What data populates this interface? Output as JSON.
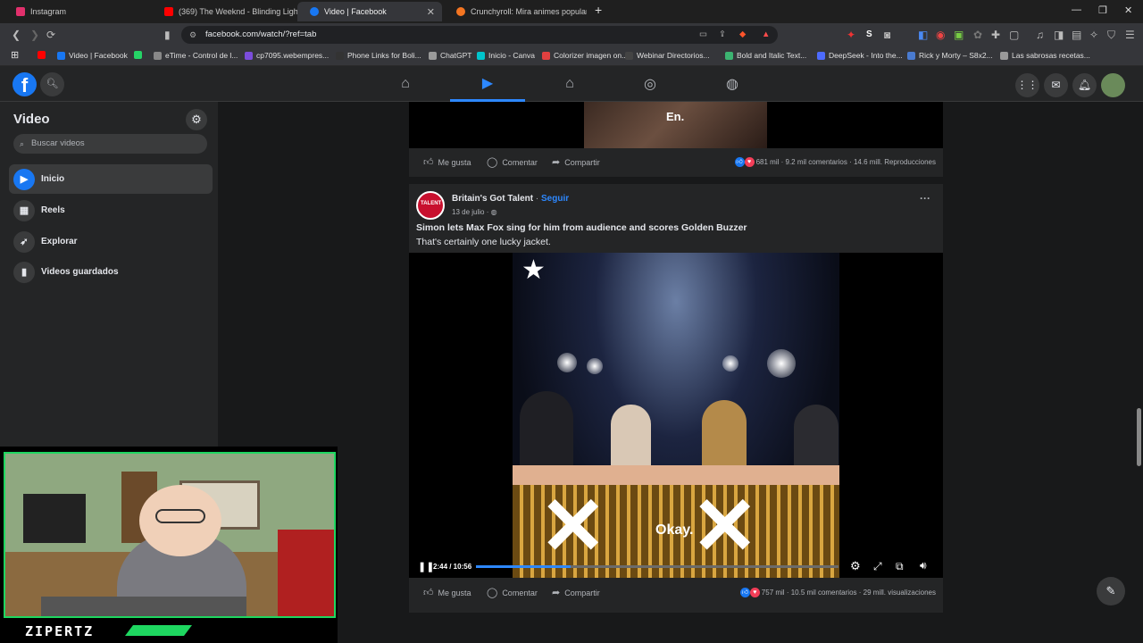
{
  "tabs": [
    {
      "label": "Instagram",
      "color": "#e1306c"
    },
    {
      "label": "(369) The Weeknd - Blinding Lights (",
      "color": "#ff0000"
    },
    {
      "label": "Video | Facebook",
      "color": "#1877f2"
    },
    {
      "label": "Crunchyroll: Mira animes populares,",
      "color": "#f47521"
    }
  ],
  "address": {
    "url": "facebook.com/watch/?ref=tab"
  },
  "bookmarks": [
    {
      "label": "",
      "color": "#ff0000"
    },
    {
      "label": "Video | Facebook",
      "color": "#1877f2"
    },
    {
      "label": "",
      "color": "#25d366"
    },
    {
      "label": "eTime - Control de l...",
      "color": "#888888"
    },
    {
      "label": "cp7095.webempres...",
      "color": "#7b4ddb"
    },
    {
      "label": "Phone Links for Boli...",
      "color": "#333333"
    },
    {
      "label": "ChatGPT",
      "color": "#9a9a9a"
    },
    {
      "label": "Inicio - Canva",
      "color": "#00c4cc"
    },
    {
      "label": "Colorizer imagen on...",
      "color": "#e04040"
    },
    {
      "label": "Webinar Directorios...",
      "color": "#444444"
    },
    {
      "label": "Bold and Italic Text...",
      "color": "#3cb371"
    },
    {
      "label": "DeepSeek - Into the...",
      "color": "#4d6bfe"
    },
    {
      "label": "Rick y Morty – S8x2...",
      "color": "#4a7bd0"
    },
    {
      "label": "Las sabrosas recetas...",
      "color": "#999999"
    }
  ],
  "sidebar": {
    "title": "Video",
    "search_placeholder": "Buscar videos",
    "items": [
      {
        "label": "Inicio",
        "icon": "play-icon",
        "active": true
      },
      {
        "label": "Reels",
        "icon": "reels-icon"
      },
      {
        "label": "Explorar",
        "icon": "rocket-icon"
      },
      {
        "label": "Videos guardados",
        "icon": "bookmark-icon"
      }
    ]
  },
  "post1": {
    "video_caption": "En.",
    "like": "Me gusta",
    "comment": "Comentar",
    "share": "Compartir",
    "reactions": "681 mil",
    "comments": "9.2 mil comentarios",
    "views": "14.6 mill. Reproducciones"
  },
  "post2": {
    "author": "Britain's Got Talent",
    "follow": "Seguir",
    "date": "13 de julio",
    "title": "Simon lets Max Fox sing for him from audience and scores Golden Buzzer",
    "subtitle": "That's certainly one lucky jacket.",
    "video_caption": "Okay.",
    "time": "2:44 / 10:56",
    "progress": 0.26,
    "like": "Me gusta",
    "comment": "Comentar",
    "share": "Compartir",
    "reactions": "757 mil",
    "comments": "10.5 mil comentarios",
    "views": "29 mill. visualizaciones"
  },
  "overlay": {
    "name": "ZIPERTZ"
  }
}
